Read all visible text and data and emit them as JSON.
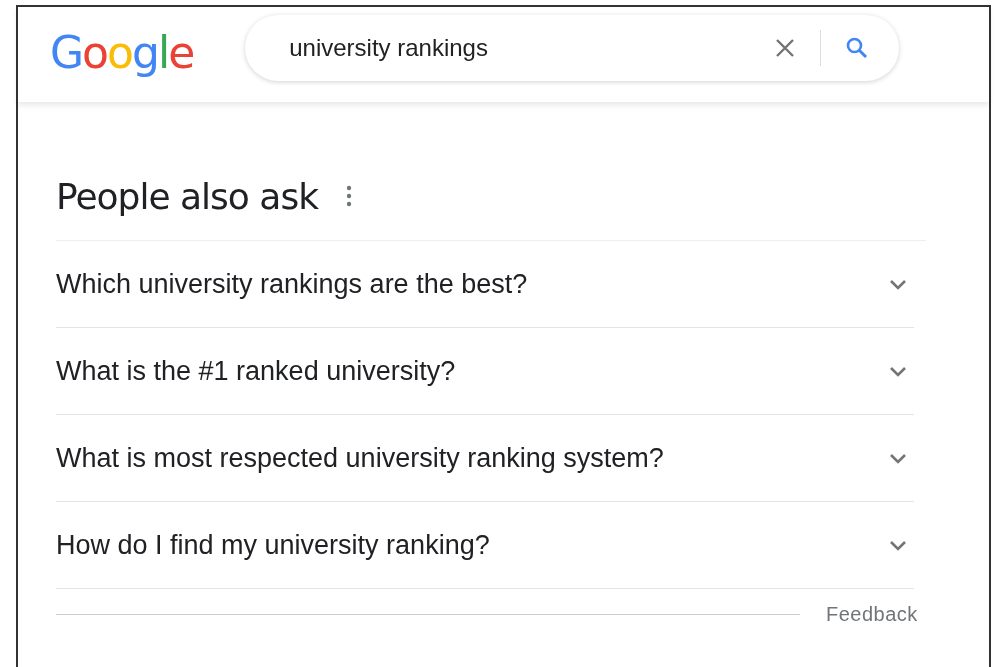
{
  "logo": [
    {
      "text": "G",
      "color": "#4285f4"
    },
    {
      "text": "o",
      "color": "#ea4335"
    },
    {
      "text": "o",
      "color": "#fbbc05"
    },
    {
      "text": "g",
      "color": "#4285f4"
    },
    {
      "text": "l",
      "color": "#34a853"
    },
    {
      "text": "e",
      "color": "#ea4335"
    }
  ],
  "search": {
    "value": "university rankings"
  },
  "section": {
    "title": "People also ask",
    "questions": [
      {
        "text": "Which university rankings are the best?",
        "expanded": false
      },
      {
        "text": "What is the #1 ranked university?",
        "expanded": false
      },
      {
        "text": "What is most respected university ranking system?",
        "expanded": false
      },
      {
        "text": "How do I find my university ranking?",
        "expanded": false
      }
    ],
    "feedback": "Feedback"
  }
}
